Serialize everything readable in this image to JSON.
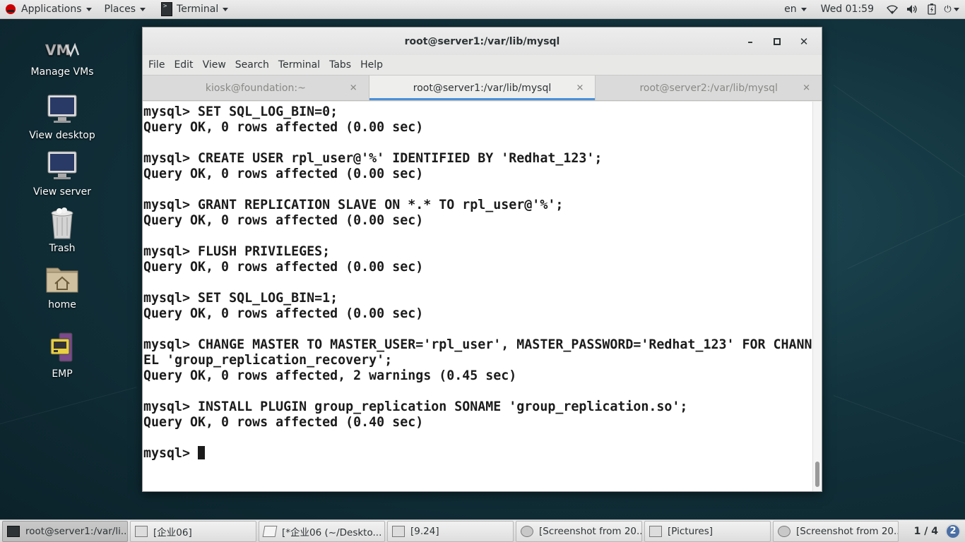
{
  "top_panel": {
    "applications": "Applications",
    "places": "Places",
    "terminal": "Terminal",
    "language": "en",
    "clock": "Wed 01:59"
  },
  "desktop": {
    "icons": [
      {
        "label": "Manage VMs"
      },
      {
        "label": "View desktop"
      },
      {
        "label": "View server"
      },
      {
        "label": "Trash"
      },
      {
        "label": "home"
      },
      {
        "label": "EMP"
      }
    ]
  },
  "window": {
    "title": "root@server1:/var/lib/mysql",
    "menu": [
      "File",
      "Edit",
      "View",
      "Search",
      "Terminal",
      "Tabs",
      "Help"
    ],
    "tabs": [
      {
        "label": "kiosk@foundation:~",
        "active": false
      },
      {
        "label": "root@server1:/var/lib/mysql",
        "active": true
      },
      {
        "label": "root@server2:/var/lib/mysql",
        "active": false
      }
    ],
    "terminal_lines": [
      "mysql> SET SQL_LOG_BIN=0;",
      "Query OK, 0 rows affected (0.00 sec)",
      "",
      "mysql> CREATE USER rpl_user@'%' IDENTIFIED BY 'Redhat_123';",
      "Query OK, 0 rows affected (0.00 sec)",
      "",
      "mysql> GRANT REPLICATION SLAVE ON *.* TO rpl_user@'%';",
      "Query OK, 0 rows affected (0.00 sec)",
      "",
      "mysql> FLUSH PRIVILEGES;",
      "Query OK, 0 rows affected (0.00 sec)",
      "",
      "mysql> SET SQL_LOG_BIN=1;",
      "Query OK, 0 rows affected (0.00 sec)",
      "",
      "mysql> CHANGE MASTER TO MASTER_USER='rpl_user', MASTER_PASSWORD='Redhat_123' FOR CHANN",
      "EL 'group_replication_recovery';",
      "Query OK, 0 rows affected, 2 warnings (0.45 sec)",
      "",
      "mysql> INSTALL PLUGIN group_replication SONAME 'group_replication.so';",
      "Query OK, 0 rows affected (0.40 sec)",
      ""
    ],
    "prompt": "mysql> "
  },
  "taskbar": {
    "items": [
      {
        "label": "root@server1:/var/li...",
        "icon": "terminal-icon",
        "active": true
      },
      {
        "label": "[企业06]",
        "icon": "folder-icon",
        "active": false
      },
      {
        "label": "[*企业06 (~/Deskto...",
        "icon": "text-editor-icon",
        "active": false
      },
      {
        "label": "[9.24]",
        "icon": "folder-icon",
        "active": false
      },
      {
        "label": "[Screenshot from 20...",
        "icon": "image-viewer-icon",
        "active": false
      },
      {
        "label": "[Pictures]",
        "icon": "folder-icon",
        "active": false
      },
      {
        "label": "[Screenshot from 20...",
        "icon": "image-viewer-icon",
        "active": false
      }
    ],
    "workspace": "1 / 4",
    "workspace_badge": "2"
  }
}
